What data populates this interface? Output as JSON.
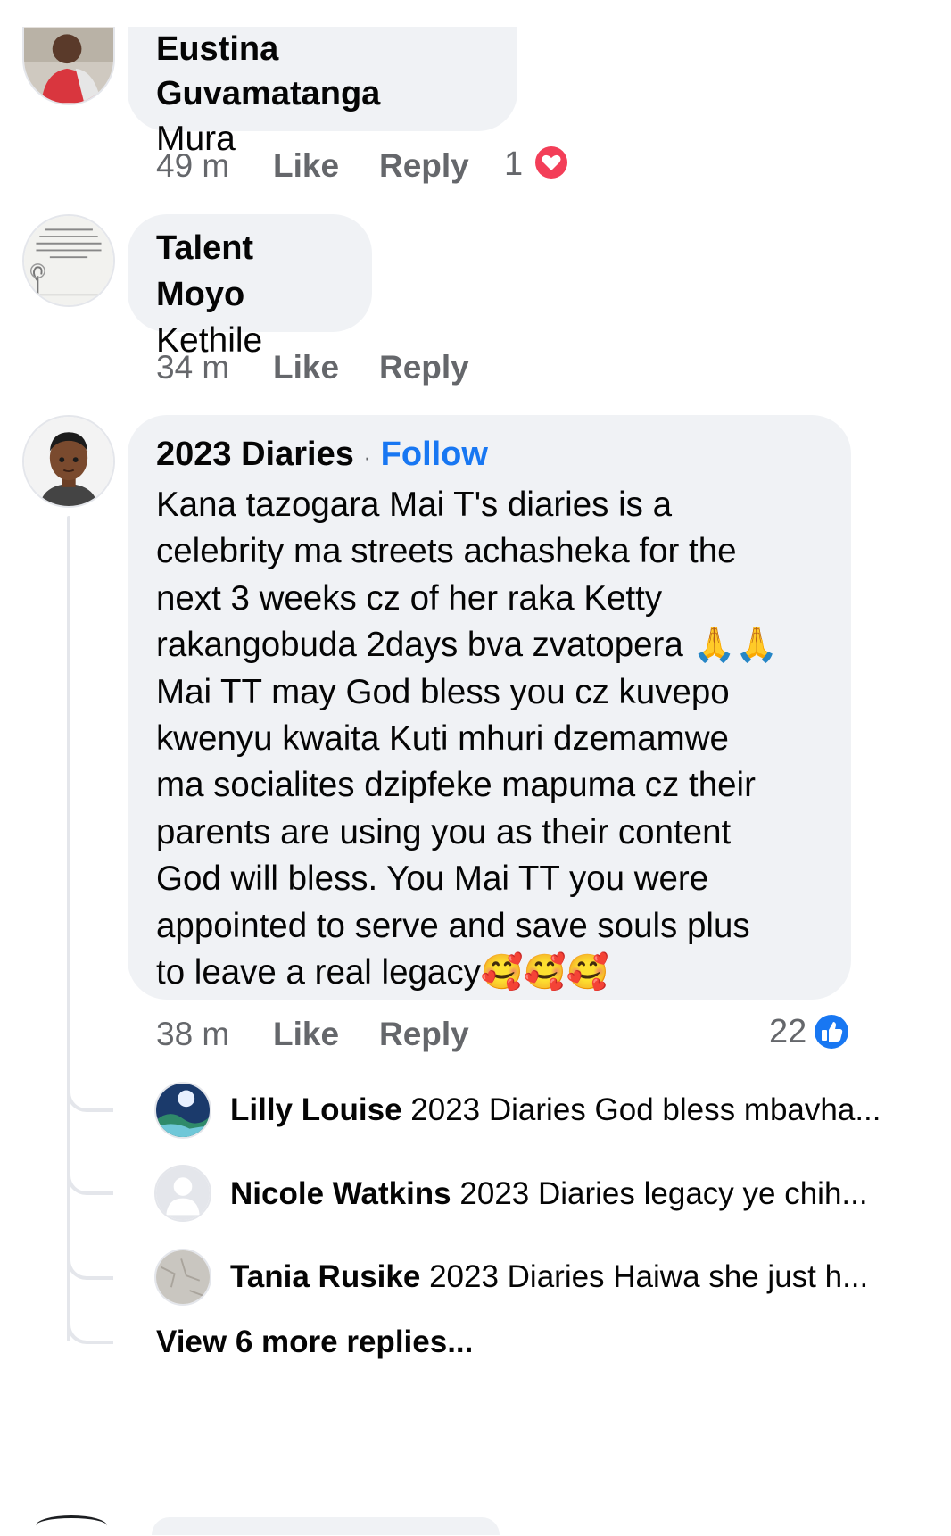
{
  "comments": [
    {
      "author": "Eustina Guvamatanga",
      "text": "Mura",
      "time": "49 m",
      "like": "Like",
      "reply": "Reply",
      "reaction_count": "1",
      "reaction_icon": "heart-icon"
    },
    {
      "author": "Talent Moyo",
      "text": "Kethile",
      "time": "34 m",
      "like": "Like",
      "reply": "Reply"
    },
    {
      "author": "2023 Diaries",
      "follow": "Follow",
      "separator": "·",
      "lines": [
        "Kana tazogara Mai T's diaries is a",
        "celebrity ma streets achasheka for the",
        "next 3 weeks cz of her raka Ketty",
        "rakangobuda 2days bva zvatopera 🙏🙏",
        "Mai TT may God bless you cz kuvepo",
        "kwenyu kwaita Kuti mhuri dzemamwe",
        "ma socialites dzipfeke mapuma cz their",
        "parents are using you as their content",
        "God will bless. You Mai TT you were",
        "appointed to serve and save souls plus",
        "to leave a real legacy🥰🥰🥰"
      ],
      "time": "38 m",
      "like": "Like",
      "reply": "Reply",
      "reaction_count": "22",
      "reaction_icon": "like-icon",
      "replies": [
        {
          "author": "Lilly Louise",
          "text": "2023 Diaries God bless mbavha..."
        },
        {
          "author": "Nicole Watkins",
          "text": "2023 Diaries legacy ye chih..."
        },
        {
          "author": "Tania Rusike",
          "text": "2023 Diaries Haiwa she just h..."
        }
      ],
      "view_more": "View 6 more replies..."
    }
  ],
  "colors": {
    "bubble": "#f0f2f5",
    "meta_text": "#65676b",
    "link_blue": "#1877f2",
    "heart_red": "#f33e58"
  }
}
